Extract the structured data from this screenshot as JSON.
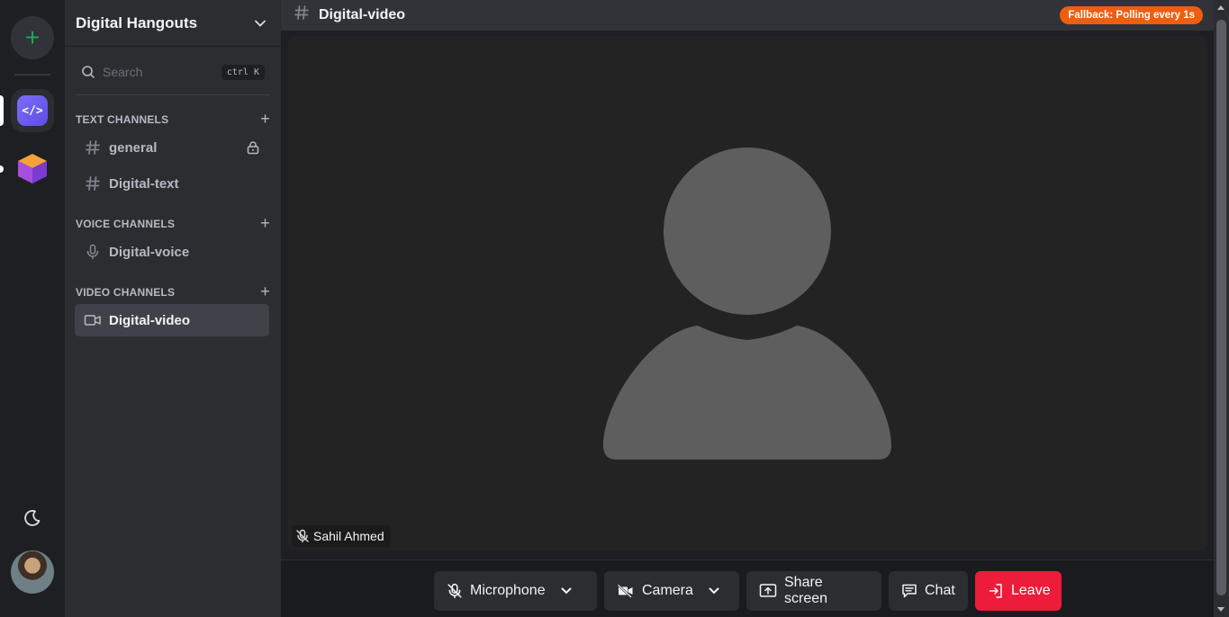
{
  "server": {
    "name": "Digital Hangouts",
    "add_label": "+"
  },
  "search": {
    "placeholder": "Search",
    "shortcut": "ctrl K"
  },
  "categories": {
    "text": "TEXT CHANNELS",
    "voice": "VOICE CHANNELS",
    "video": "VIDEO CHANNELS"
  },
  "channels": {
    "general": "general",
    "digital_text": "Digital-text",
    "digital_voice": "Digital-voice",
    "digital_video": "Digital-video"
  },
  "header": {
    "channel_title": "Digital-video",
    "status_badge": "Fallback: Polling every 1s"
  },
  "stage": {
    "participant_name": "Sahil Ahmed"
  },
  "controls": {
    "microphone": "Microphone",
    "camera": "Camera",
    "share_screen": "Share screen",
    "chat": "Chat",
    "leave": "Leave"
  },
  "colors": {
    "accent_green": "#23a55a",
    "badge_orange": "#ef5d0e",
    "leave_red": "#ed1c3a",
    "active_channel": "#404249"
  },
  "icons": [
    "plus-icon",
    "code-icon",
    "cube-icon",
    "moon-icon",
    "chevron-down-icon",
    "search-icon",
    "hash-icon",
    "lock-icon",
    "microphone-icon",
    "video-camera-icon",
    "mic-off-icon",
    "camera-off-icon",
    "share-screen-icon",
    "chat-icon",
    "leave-icon"
  ]
}
